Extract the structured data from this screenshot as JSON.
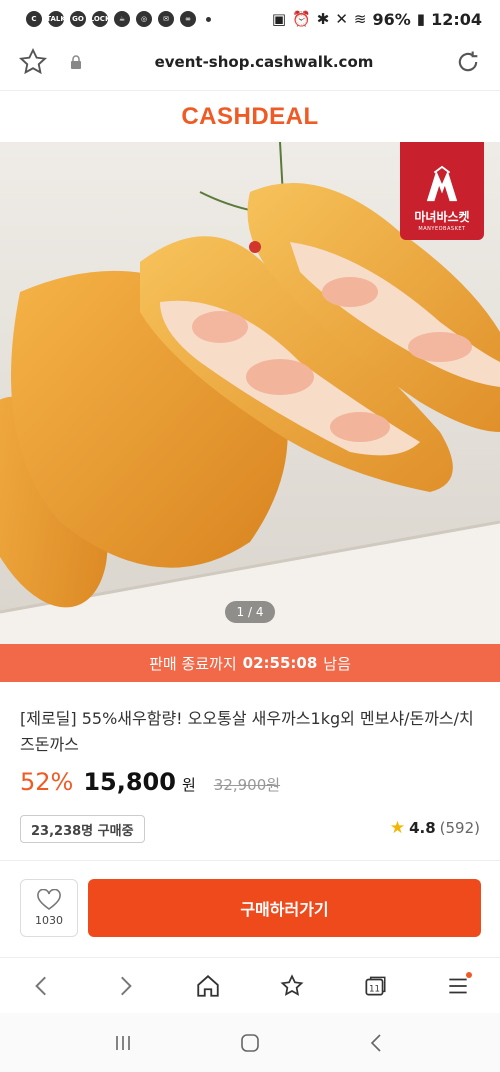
{
  "status_bar": {
    "battery": "96%",
    "time": "12:04",
    "app_icons": [
      "C",
      "TALK",
      "GO",
      "LOCK"
    ]
  },
  "browser": {
    "url": "event-shop.cashwalk.com"
  },
  "brand": {
    "logo_text": "CASHDEAL",
    "accent_color": "#f05a24"
  },
  "product": {
    "image_counter": "1 / 4",
    "brand_badge": {
      "name": "마녀바스켓",
      "sub": "MANYEOBASKET"
    },
    "timer_label": "판매 종료까지",
    "timer_value": "02:55:08",
    "timer_suffix": "남음",
    "title": "[제로딜] 55%새우함량! 오오통살 새우까스1kg외 멘보샤/돈까스/치즈돈까스",
    "discount": "52%",
    "price": "15,800",
    "currency": "원",
    "original_price": "32,900원",
    "buyers": "23,238명 구매중",
    "rating": "4.8",
    "rating_count": "(592)"
  },
  "actions": {
    "like_count": "1030",
    "buy_label": "구매하러가기",
    "buy_color": "#ef4a1c"
  },
  "browser_nav": {
    "tab_count": "11"
  }
}
